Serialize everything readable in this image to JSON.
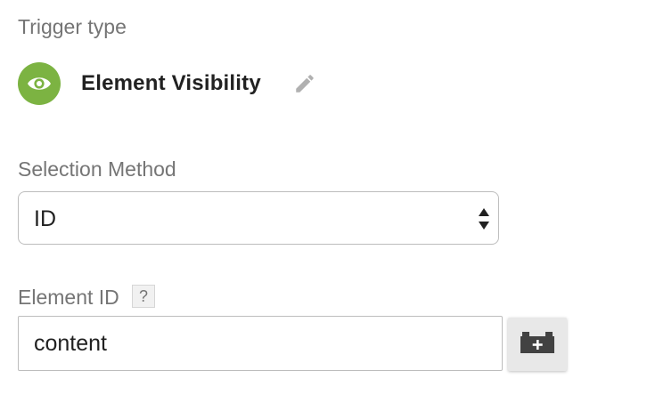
{
  "trigger": {
    "section_label": "Trigger type",
    "name": "Element Visibility",
    "icon": "eye-icon",
    "icon_color": "#7cb342"
  },
  "selection_method": {
    "label": "Selection Method",
    "selected": "ID"
  },
  "element_id": {
    "label": "Element ID",
    "help": "?",
    "value": "content"
  },
  "icons": {
    "edit": "pencil-icon",
    "variable": "variable-block-add-icon"
  }
}
